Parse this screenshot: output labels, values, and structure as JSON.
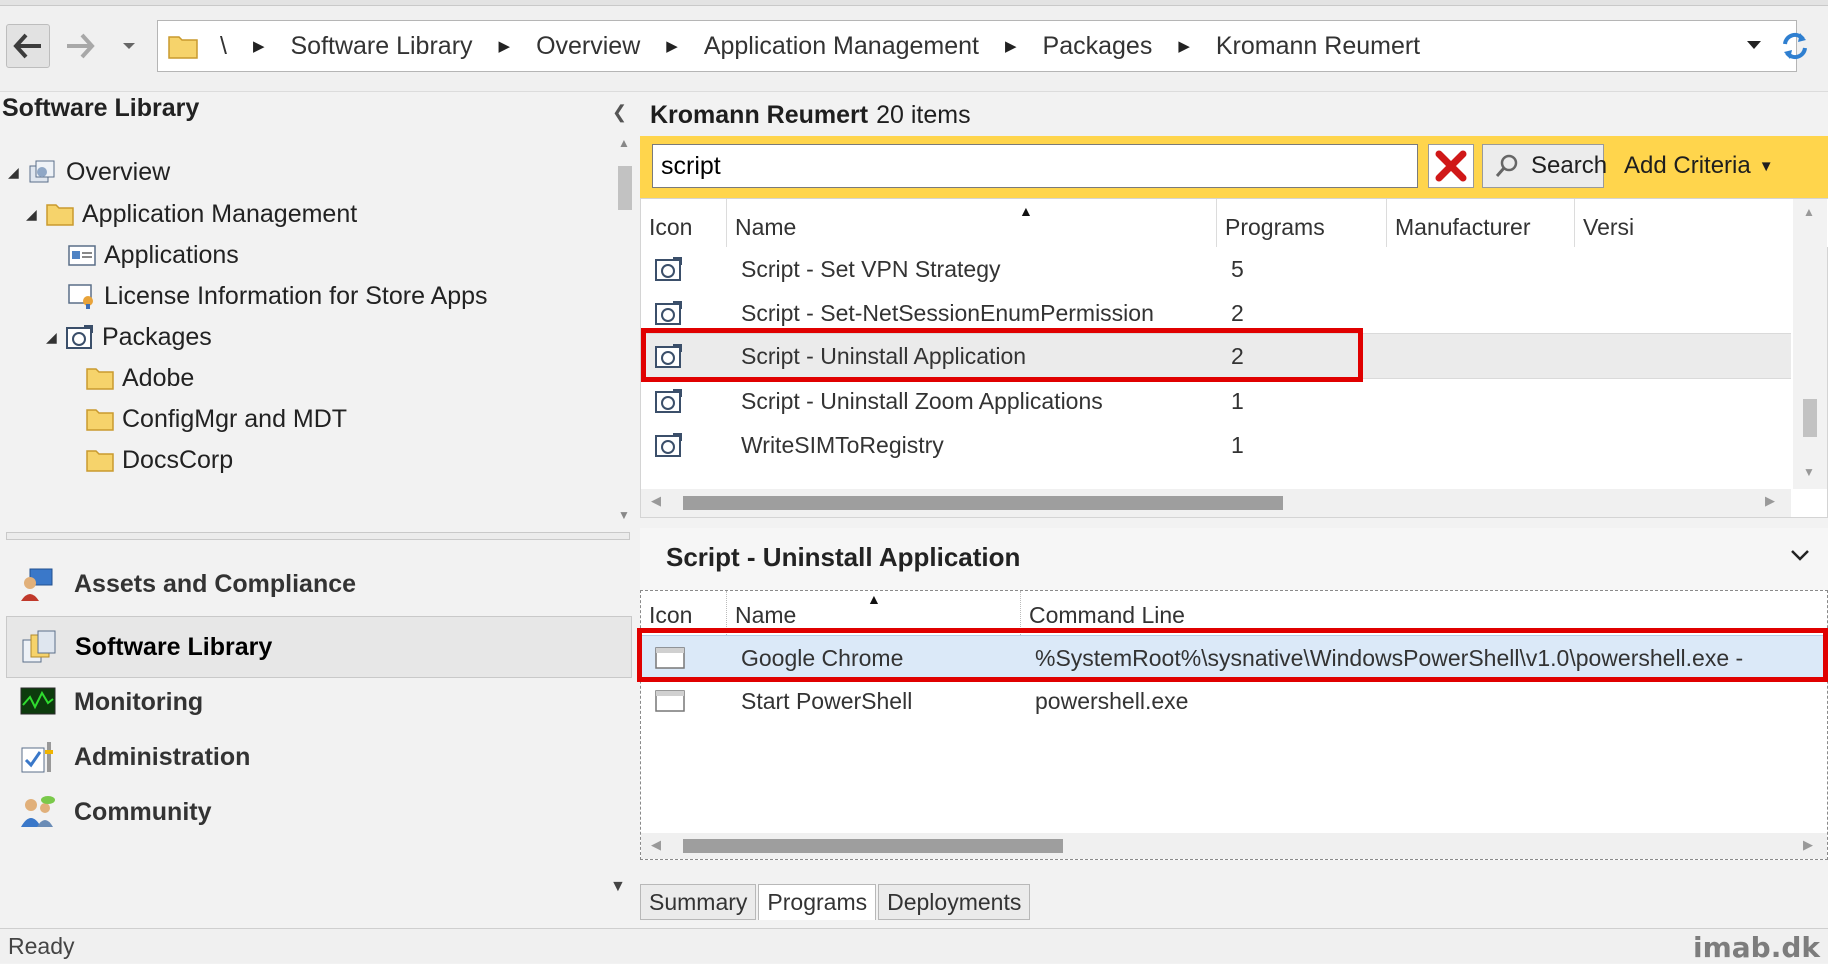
{
  "address_bar": {
    "crumbs": [
      "\\",
      "Software Library",
      "Overview",
      "Application Management",
      "Packages",
      "Kromann Reumert"
    ]
  },
  "left": {
    "title": "Software Library",
    "tree": [
      {
        "label": "Overview",
        "icon": "overview-icon",
        "level": 0,
        "expanded": true
      },
      {
        "label": "Application Management",
        "icon": "folder-icon",
        "level": 1,
        "expanded": true
      },
      {
        "label": "Applications",
        "icon": "applications-icon",
        "level": 2
      },
      {
        "label": "License Information for Store Apps",
        "icon": "license-icon",
        "level": 2
      },
      {
        "label": "Packages",
        "icon": "package-icon",
        "level": 2,
        "expanded": true
      },
      {
        "label": "Adobe",
        "icon": "folder-icon",
        "level": 3
      },
      {
        "label": "ConfigMgr and MDT",
        "icon": "folder-icon",
        "level": 3
      },
      {
        "label": "DocsCorp",
        "icon": "folder-icon",
        "level": 3
      }
    ],
    "workspaces": [
      {
        "label": "Assets and Compliance",
        "icon": "assets-compliance-icon"
      },
      {
        "label": "Software Library",
        "icon": "software-library-icon",
        "selected": true
      },
      {
        "label": "Monitoring",
        "icon": "monitoring-icon"
      },
      {
        "label": "Administration",
        "icon": "administration-icon"
      },
      {
        "label": "Community",
        "icon": "community-icon"
      }
    ]
  },
  "main": {
    "folder_name": "Kromann Reumert",
    "item_count": "20 items",
    "search": {
      "value": "script",
      "button": "Search",
      "add_criteria": "Add Criteria"
    },
    "columns": [
      "Icon",
      "Name",
      "Programs",
      "Manufacturer",
      "Versi"
    ],
    "rows": [
      {
        "name": "Script - Set VPN Strategy",
        "programs": "5"
      },
      {
        "name": "Script - Set-NetSessionEnumPermission",
        "programs": "2"
      },
      {
        "name": "Script - Uninstall Application",
        "programs": "2",
        "selected": true
      },
      {
        "name": "Script - Uninstall Zoom Applications",
        "programs": "1"
      },
      {
        "name": "WriteSIMToRegistry",
        "programs": "1"
      }
    ]
  },
  "details": {
    "title": "Script - Uninstall Application",
    "columns": [
      "Icon",
      "Name",
      "Command Line"
    ],
    "rows": [
      {
        "name": "Google Chrome",
        "command": "%SystemRoot%\\sysnative\\WindowsPowerShell\\v1.0\\powershell.exe -",
        "selected": true
      },
      {
        "name": "Start PowerShell",
        "command": "powershell.exe"
      }
    ],
    "tabs": [
      "Summary",
      "Programs",
      "Deployments"
    ],
    "active_tab": "Programs"
  },
  "status": {
    "text": "Ready",
    "watermark": "imab.dk"
  },
  "colors": {
    "search_bar": "#ffd54c",
    "highlight": "#e00000",
    "selection": "#dbe9f8"
  }
}
